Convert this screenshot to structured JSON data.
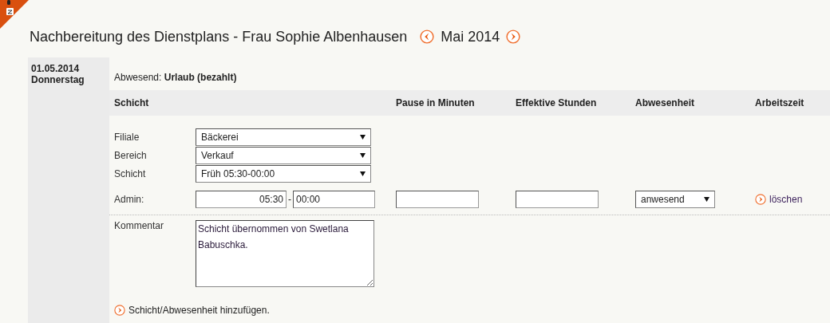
{
  "header": {
    "title": "Nachbereitung des Dienstplans - Frau Sophie Albenhausen",
    "month": "Mai 2014"
  },
  "day": {
    "date": "01.05.2014",
    "weekday": "Donnerstag"
  },
  "absence": {
    "label": "Abwesend:",
    "value": "Urlaub (bezahlt)"
  },
  "columns": [
    "Schicht",
    "Pause in Minuten",
    "Effektive Stunden",
    "Abwesenheit",
    "Arbeitszeit"
  ],
  "selects": [
    {
      "label": "Filiale",
      "value": "Bäckerei"
    },
    {
      "label": "Bereich",
      "value": "Verkauf"
    },
    {
      "label": "Schicht",
      "value": "Früh 05:30-00:00"
    }
  ],
  "admin": {
    "label": "Admin:",
    "start": "05:30",
    "separator": "-",
    "end": "00:00",
    "status": "anwesend",
    "delete": "löschen"
  },
  "comment": {
    "label": "Kommentar",
    "value": "Schicht übernommen von Swetlana Babuschka."
  },
  "add_link": "Schicht/Abwesenheit hinzufügen."
}
